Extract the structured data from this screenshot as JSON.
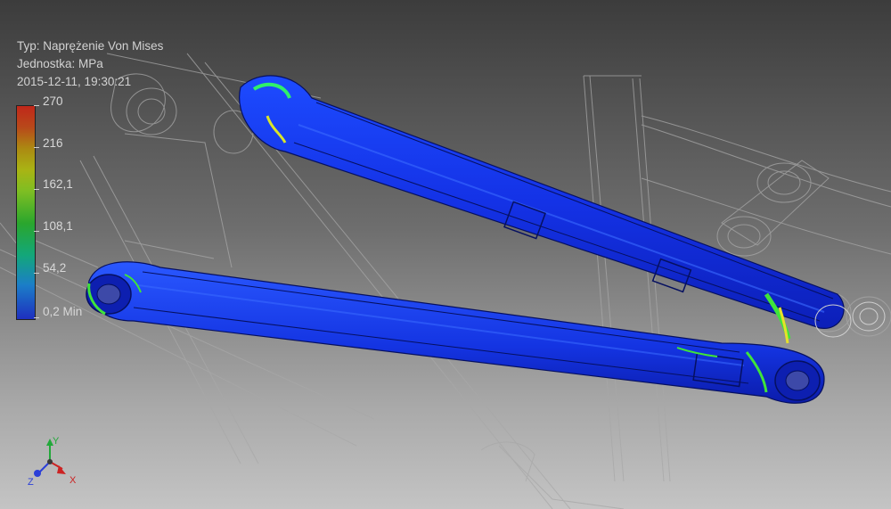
{
  "info": {
    "type_label": "Typ: Naprężenie Von Mises",
    "unit_label": "Jednostka: MPa",
    "timestamp": "2015-12-11, 19:30:21"
  },
  "legend": {
    "labels": [
      "270",
      "216",
      "162,1",
      "108,1",
      "54,2",
      "0,2 Min"
    ]
  },
  "triad": {
    "x_label": "X",
    "y_label": "Y",
    "z_label": "Z"
  },
  "colors": {
    "part_blue": "#1430e0",
    "stress_green": "#3fdc2a",
    "stress_yellow": "#e6e12a",
    "wireframe": "#9a9a9a",
    "axis_x": "#cc2222",
    "axis_y": "#22a83a",
    "axis_z": "#2b3fd8"
  }
}
